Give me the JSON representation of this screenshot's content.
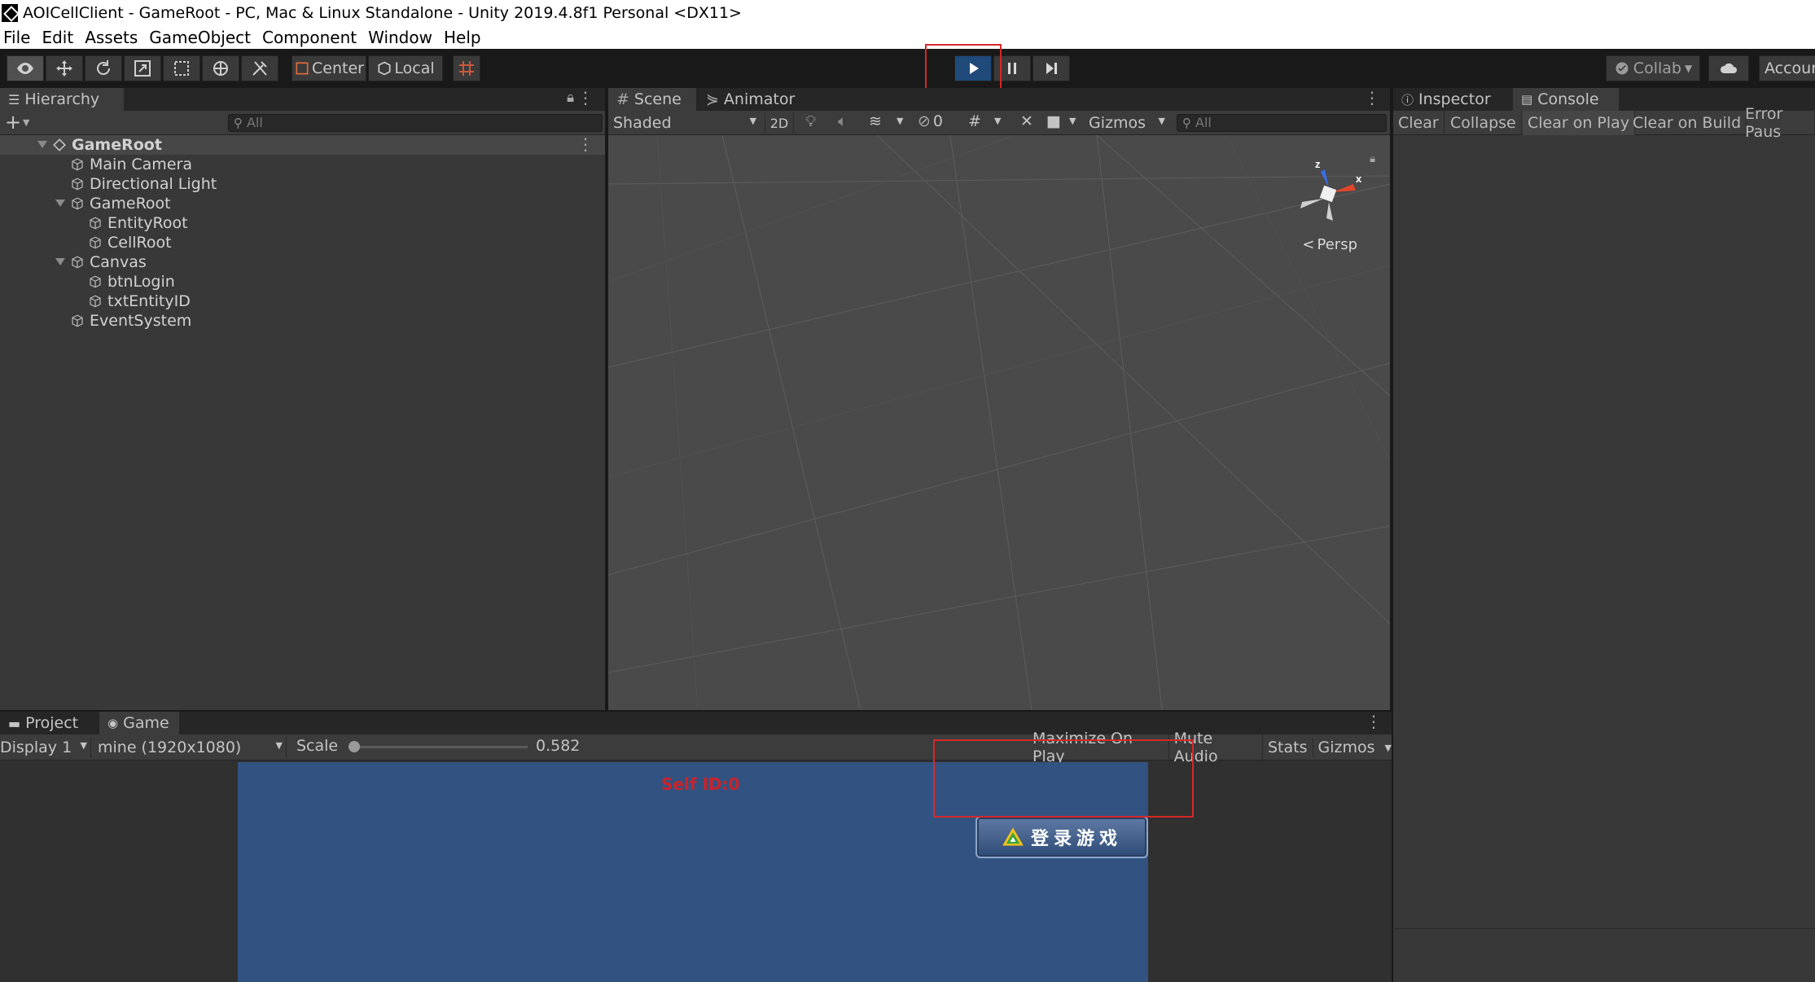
{
  "window": {
    "title": "AOICellClient - GameRoot - PC, Mac & Linux Standalone - Unity 2019.4.8f1 Personal <DX11>"
  },
  "menu": [
    "File",
    "Edit",
    "Assets",
    "GameObject",
    "Component",
    "Window",
    "Help"
  ],
  "toolbar": {
    "center_label": "Center",
    "local_label": "Local",
    "collab_label": "Collab",
    "account_label": "Accour"
  },
  "hierarchy": {
    "tab": "Hierarchy",
    "search_placeholder": "All",
    "items": [
      {
        "label": "GameRoot"
      },
      {
        "label": "Main Camera"
      },
      {
        "label": "Directional Light"
      },
      {
        "label": "GameRoot"
      },
      {
        "label": "EntityRoot"
      },
      {
        "label": "CellRoot"
      },
      {
        "label": "Canvas"
      },
      {
        "label": "btnLogin"
      },
      {
        "label": "txtEntityID"
      },
      {
        "label": "EventSystem"
      }
    ]
  },
  "scene": {
    "tabs": [
      "Scene",
      "Animator"
    ],
    "shading": "Shaded",
    "mode_2d": "2D",
    "hidden_count": "0",
    "gizmos_label": "Gizmos",
    "search_placeholder": "All",
    "projection": "Persp",
    "axis_x": "x",
    "axis_z": "z"
  },
  "console": {
    "tabs": [
      "Inspector",
      "Console"
    ],
    "buttons": [
      "Clear",
      "Collapse",
      "Clear on Play",
      "Clear on Build",
      "Error Paus"
    ]
  },
  "game": {
    "tabs": [
      "Project",
      "Game"
    ],
    "display": "Display 1",
    "resolution": "mine (1920x1080)",
    "scale_label": "Scale",
    "scale_value": "0.582",
    "scale_fraction": 0.0,
    "options": [
      "Maximize On Play",
      "Mute Audio",
      "Stats",
      "Gizmos"
    ],
    "self_id_text": "Self ID:0",
    "login_button": "登录游戏"
  },
  "colors": {
    "play_active": "#1f4a7a",
    "highlight_box": "#d62828",
    "game_bg": "#325382"
  }
}
